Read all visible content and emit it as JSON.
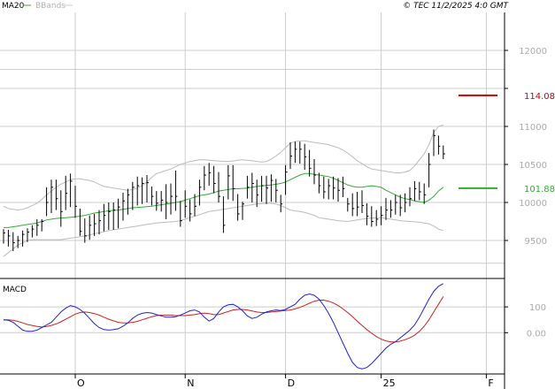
{
  "header": {
    "ma_label": "MA20",
    "bbands_label": "BBands",
    "copyright": "© TEC 11/2/2025 4:0 GMT",
    "ma_color": "#33aa33",
    "bbands_color": "#b0b0b0"
  },
  "colors": {
    "price_bars": "#000000",
    "ma": "#33aa33",
    "bbands": "#bbbbbb",
    "resistance": "#cc0000",
    "support": "#33aa33",
    "macd": "#2222cc",
    "signal": "#cc2222",
    "grid": "#cccccc"
  },
  "chart_data": [
    {
      "type": "line",
      "panel": "price",
      "ylim": [
        9000,
        12500
      ],
      "y_ticks": [
        12000,
        11500,
        11000,
        10500,
        10000,
        9500
      ],
      "y_tick_labels": [
        "12000",
        "",
        "11000",
        "10500",
        "10000",
        "9500"
      ],
      "x_months": [
        {
          "label": "O",
          "day": 15
        },
        {
          "label": "N",
          "day": 38
        },
        {
          "label": "D",
          "day": 59
        },
        {
          "label": "25",
          "day": 79
        },
        {
          "label": "F",
          "day": 101
        }
      ],
      "levels": [
        {
          "name": "resistance",
          "label": "114.08",
          "value": 11408
        },
        {
          "name": "support",
          "label": "101.88",
          "value": 10188
        }
      ],
      "ohlc": {
        "high": [
          9650,
          9640,
          9610,
          9560,
          9630,
          9660,
          9700,
          9780,
          9780,
          10200,
          10300,
          10300,
          10160,
          10350,
          10380,
          10220,
          9920,
          9790,
          9830,
          9850,
          9900,
          9980,
          10000,
          10000,
          10050,
          10130,
          10180,
          10270,
          10340,
          10330,
          10360,
          10210,
          10150,
          10150,
          10240,
          10250,
          10420,
          10020,
          10160,
          10040,
          10110,
          10300,
          10480,
          10520,
          10480,
          10400,
          10080,
          10490,
          10490,
          10110,
          10010,
          10350,
          10390,
          10300,
          10350,
          10350,
          10370,
          10310,
          10100,
          10490,
          10790,
          10800,
          10800,
          10770,
          10690,
          10570,
          10390,
          10340,
          10310,
          10340,
          10320,
          10340,
          10060,
          10120,
          10140,
          10160,
          9990,
          9950,
          9900,
          9950,
          10060,
          10030,
          10100,
          10100,
          10120,
          10200,
          10280,
          10270,
          10250,
          10650,
          10960,
          10880,
          10750
        ],
        "low": [
          9460,
          9420,
          9360,
          9400,
          9420,
          9480,
          9540,
          9560,
          9620,
          9820,
          9860,
          9900,
          9680,
          9900,
          9940,
          9800,
          9560,
          9470,
          9510,
          9560,
          9580,
          9620,
          9640,
          9640,
          9660,
          9760,
          9840,
          9900,
          9960,
          9980,
          10000,
          9960,
          9890,
          9880,
          9780,
          9840,
          9890,
          9680,
          9800,
          9750,
          9820,
          9960,
          10160,
          10220,
          10120,
          10000,
          9600,
          10040,
          10020,
          9760,
          9770,
          10050,
          10000,
          9940,
          10010,
          9980,
          10010,
          10000,
          9870,
          10100,
          10440,
          10520,
          10510,
          10430,
          10340,
          10240,
          10120,
          10050,
          10040,
          10040,
          10010,
          10070,
          9880,
          9820,
          9820,
          9860,
          9700,
          9680,
          9690,
          9700,
          9770,
          9800,
          9840,
          9820,
          9870,
          9950,
          10020,
          10030,
          9980,
          10200,
          10610,
          10630,
          10570
        ],
        "close": [
          9600,
          9560,
          9470,
          9500,
          9580,
          9610,
          9650,
          9700,
          9750,
          10000,
          10200,
          10050,
          9880,
          10120,
          10280,
          9950,
          9620,
          9560,
          9700,
          9720,
          9760,
          9830,
          9880,
          9900,
          9940,
          10020,
          10100,
          10200,
          10220,
          10250,
          10260,
          10080,
          9990,
          10030,
          10000,
          10080,
          10080,
          9760,
          9950,
          9850,
          9950,
          10200,
          10360,
          10390,
          10250,
          10080,
          9700,
          10350,
          10180,
          9850,
          9980,
          10200,
          10250,
          10100,
          10220,
          10190,
          10290,
          10160,
          9980,
          10400,
          10610,
          10700,
          10700,
          10600,
          10450,
          10360,
          10220,
          10140,
          10220,
          10190,
          10160,
          10180,
          9980,
          9920,
          9940,
          9960,
          9820,
          9750,
          9780,
          9830,
          9900,
          9900,
          10000,
          9930,
          10000,
          10050,
          10180,
          10140,
          10100,
          10500,
          10880,
          10740,
          10640
        ]
      },
      "series": [
        {
          "name": "MA20",
          "values": [
            9670,
            9670,
            9680,
            9690,
            9700,
            9710,
            9720,
            9730,
            9750,
            9770,
            9780,
            9790,
            9795,
            9800,
            9805,
            9810,
            9820,
            9830,
            9845,
            9860,
            9870,
            9880,
            9890,
            9895,
            9900,
            9910,
            9920,
            9930,
            9935,
            9940,
            9945,
            9950,
            9960,
            9970,
            9980,
            9990,
            10000,
            10010,
            10030,
            10050,
            10070,
            10090,
            10100,
            10110,
            10130,
            10150,
            10160,
            10170,
            10180,
            10180,
            10185,
            10190,
            10200,
            10210,
            10220,
            10225,
            10230,
            10240,
            10250,
            10270,
            10300,
            10330,
            10360,
            10380,
            10380,
            10370,
            10360,
            10350,
            10340,
            10320,
            10290,
            10260,
            10230,
            10210,
            10200,
            10200,
            10210,
            10220,
            10210,
            10200,
            10160,
            10130,
            10100,
            10070,
            10050,
            10040,
            10020,
            10010,
            10000,
            10030,
            10080,
            10150,
            10200
          ]
        },
        {
          "name": "BBands upper",
          "values": [
            9950,
            9920,
            9910,
            9900,
            9910,
            9930,
            9960,
            9990,
            10040,
            10100,
            10150,
            10200,
            10240,
            10270,
            10300,
            10310,
            10310,
            10300,
            10290,
            10270,
            10240,
            10210,
            10200,
            10190,
            10180,
            10170,
            10160,
            10170,
            10190,
            10220,
            10270,
            10330,
            10380,
            10400,
            10420,
            10440,
            10470,
            10500,
            10520,
            10540,
            10550,
            10560,
            10560,
            10555,
            10550,
            10545,
            10540,
            10540,
            10545,
            10555,
            10560,
            10555,
            10550,
            10540,
            10530,
            10540,
            10570,
            10610,
            10660,
            10720,
            10780,
            10800,
            10810,
            10810,
            10800,
            10790,
            10780,
            10770,
            10760,
            10740,
            10720,
            10690,
            10650,
            10600,
            10550,
            10510,
            10470,
            10440,
            10430,
            10420,
            10410,
            10400,
            10390,
            10390,
            10400,
            10420,
            10480,
            10560,
            10640,
            10760,
            10920,
            11000,
            11020
          ]
        },
        {
          "name": "BBands lower",
          "values": [
            9290,
            9340,
            9390,
            9440,
            9470,
            9500,
            9510,
            9510,
            9510,
            9510,
            9510,
            9510,
            9510,
            9520,
            9530,
            9540,
            9550,
            9560,
            9570,
            9590,
            9600,
            9615,
            9630,
            9640,
            9650,
            9660,
            9670,
            9680,
            9690,
            9700,
            9710,
            9720,
            9730,
            9735,
            9740,
            9745,
            9750,
            9760,
            9780,
            9800,
            9820,
            9840,
            9860,
            9880,
            9890,
            9900,
            9910,
            9920,
            9930,
            9940,
            9950,
            9960,
            9970,
            9980,
            9985,
            9990,
            9990,
            9980,
            9960,
            9930,
            9900,
            9890,
            9880,
            9870,
            9850,
            9830,
            9800,
            9790,
            9780,
            9770,
            9760,
            9755,
            9750,
            9760,
            9770,
            9780,
            9790,
            9795,
            9800,
            9800,
            9790,
            9780,
            9770,
            9760,
            9755,
            9750,
            9745,
            9740,
            9730,
            9720,
            9690,
            9650,
            9630
          ]
        }
      ]
    },
    {
      "type": "line",
      "panel": "macd",
      "title": "MACD",
      "ylim": [
        -160,
        210
      ],
      "y_ticks": [
        100,
        0
      ],
      "y_tick_labels": [
        "100",
        "0.00"
      ],
      "series": [
        {
          "name": "MACD",
          "values": [
            50,
            48,
            40,
            25,
            10,
            5,
            5,
            10,
            20,
            30,
            40,
            60,
            80,
            95,
            105,
            100,
            90,
            75,
            55,
            35,
            20,
            12,
            10,
            12,
            15,
            25,
            38,
            55,
            68,
            75,
            78,
            76,
            70,
            65,
            60,
            60,
            62,
            68,
            76,
            85,
            88,
            80,
            60,
            45,
            55,
            80,
            100,
            108,
            110,
            100,
            85,
            65,
            55,
            60,
            72,
            80,
            85,
            88,
            86,
            90,
            100,
            110,
            130,
            145,
            150,
            145,
            130,
            105,
            75,
            40,
            0,
            -40,
            -80,
            -115,
            -135,
            -140,
            -135,
            -120,
            -100,
            -80,
            -60,
            -45,
            -35,
            -20,
            -5,
            10,
            30,
            60,
            95,
            130,
            160,
            180,
            190
          ]
        },
        {
          "name": "Signal",
          "values": [
            50,
            50,
            48,
            44,
            38,
            32,
            28,
            24,
            22,
            24,
            28,
            34,
            42,
            52,
            62,
            72,
            78,
            80,
            78,
            74,
            68,
            60,
            52,
            46,
            40,
            38,
            38,
            40,
            44,
            50,
            56,
            62,
            66,
            68,
            68,
            68,
            66,
            66,
            66,
            68,
            70,
            74,
            76,
            74,
            70,
            70,
            76,
            82,
            88,
            90,
            90,
            88,
            84,
            80,
            78,
            78,
            80,
            82,
            84,
            86,
            88,
            92,
            98,
            106,
            114,
            122,
            126,
            126,
            122,
            115,
            105,
            92,
            78,
            62,
            45,
            28,
            12,
            -2,
            -15,
            -25,
            -32,
            -36,
            -36,
            -33,
            -27,
            -20,
            -10,
            5,
            25,
            50,
            80,
            110,
            140
          ]
        }
      ]
    }
  ]
}
